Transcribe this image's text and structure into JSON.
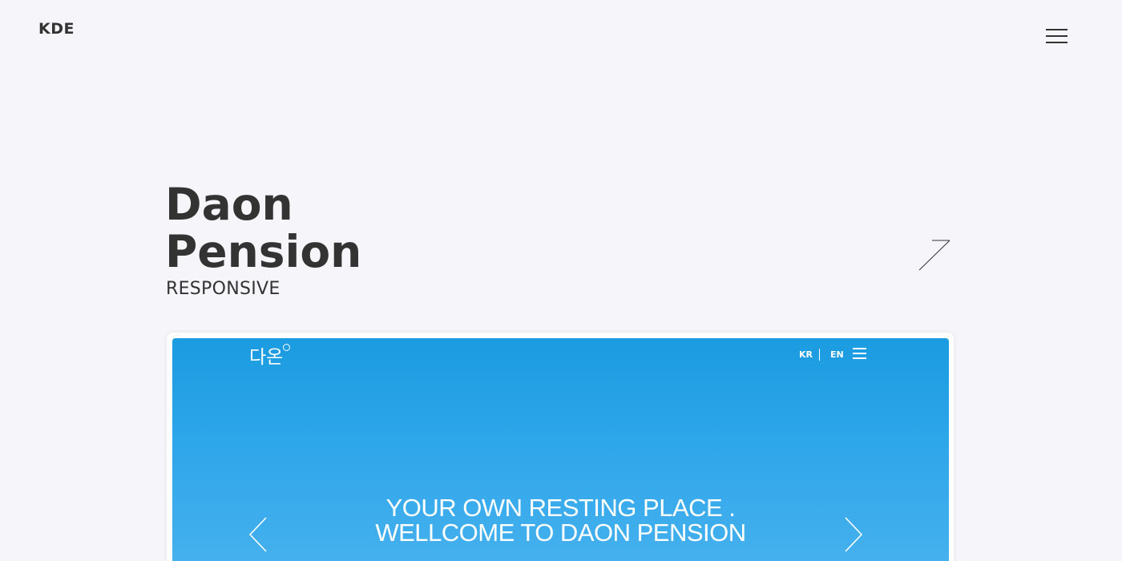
{
  "header": {
    "brand": "KDE",
    "menu_icon": "hamburger-menu-icon"
  },
  "project": {
    "title_line1": "Daon",
    "title_line2": "Pension",
    "subtitle": "RESPONSIVE",
    "link_icon": "diagonal-arrow-icon"
  },
  "preview": {
    "logo": "다온",
    "lang_kr": "KR",
    "lang_en": "EN",
    "menu_icon": "hamburger-menu-icon",
    "hero_line1": "YOUR OWN RESTING PLACE .",
    "hero_line2": "WELLCOME TO DAON PENSION",
    "prev_icon": "chevron-left-icon",
    "next_icon": "chevron-right-icon"
  },
  "colors": {
    "background": "#f6f6fa",
    "text": "#333333",
    "preview_sky": "#2ea6ea"
  }
}
